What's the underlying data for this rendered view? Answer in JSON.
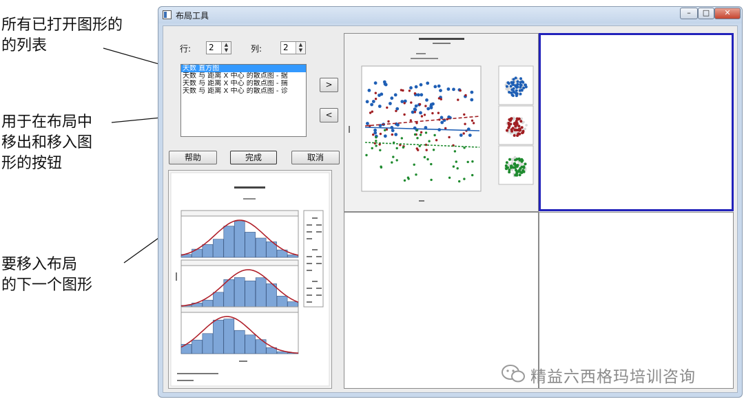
{
  "annotations": {
    "list_of_graphs": "所有已打开图形的\n的列表",
    "move_buttons": "用于在布局中\n移出和移入图\n形的按钮",
    "next_graph": "要移入布局\n的下一个图形"
  },
  "window": {
    "title": "布局工具",
    "min_label": "–",
    "max_label": "□",
    "close_label": "✕"
  },
  "rows": {
    "label": "行:",
    "value": "2"
  },
  "cols": {
    "label": "列:",
    "value": "2"
  },
  "graph_list": [
    "天数 直方图",
    "天数 与 距离 X 中心 的散点图 - 据",
    "天数 与 距离 X 中心 的散点图 - 揣",
    "天数 与 距离 X 中心 的散点图 - 诊"
  ],
  "buttons": {
    "move_in": ">",
    "move_out": "<",
    "help": "帮助",
    "finish": "完成",
    "cancel": "取消"
  },
  "icons": {
    "window_icon": "layout-window-icon",
    "watermark_icon": "wechat-icon"
  },
  "colors": {
    "selection": "#3399ff",
    "active_cell_border": "#2222bb",
    "bar_fill": "#7ea6d8",
    "fit_curve": "#b0202a",
    "series_blue": "#1f5fb5",
    "series_red": "#a01e22",
    "series_green": "#1e8a2e"
  },
  "watermark": "精益六西格玛培训咨询"
}
